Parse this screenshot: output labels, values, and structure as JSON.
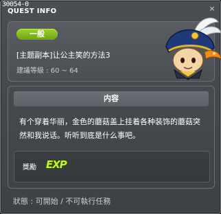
{
  "window": {
    "quest_id": "30054-0",
    "title": "QUEST INFO",
    "close_glyph": "×"
  },
  "header": {
    "category": "一般",
    "quest_title": "[主题副本]让公主笑的方法3",
    "level_requirement": "建議等級 : 60 ~ 64",
    "npc_portrait": "mushroom-knight-portrait-icon"
  },
  "content": {
    "section_title": "内容",
    "description": "有个穿着华丽，金色的蘑菇盖上挂着各种装饰的蘑菇突然和我说话。听听到底是什么事吧。",
    "reward_label": "獎勵",
    "reward_item": "EXP"
  },
  "status": {
    "text": "狀態 : 可開始 / 不可執行任務"
  },
  "colors": {
    "category_green": "#8cc420",
    "exp_green": "#c6f135",
    "panel_bg": "#4b4f54"
  }
}
